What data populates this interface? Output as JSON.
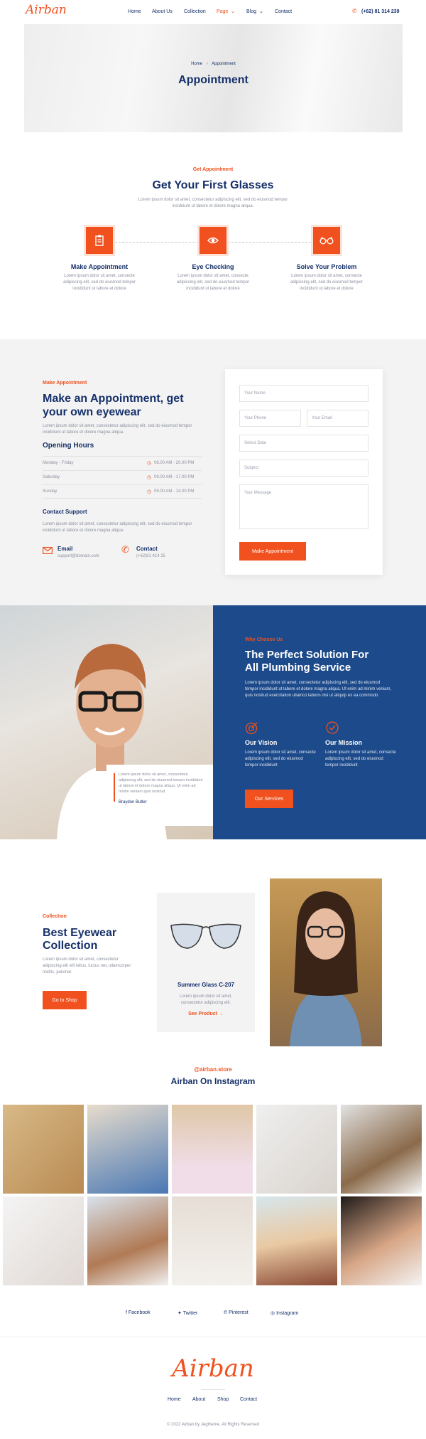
{
  "header": {
    "logo": "Airban",
    "nav": [
      "Home",
      "About Us",
      "Collection",
      "Page",
      "Blog",
      "Contact"
    ],
    "phone": "(+62) 81 314 239"
  },
  "hero": {
    "breadcrumb_home": "Home",
    "breadcrumb_current": "Appointment",
    "title": "Appointment"
  },
  "steps_section": {
    "eyebrow": "Get Appointment",
    "title": "Get Your First Glasses",
    "intro": "Lorem ipsum dolor sit amet, consectetur adipiscing elit, sed do eiusmod tempor incididunt ut labore et dolore magna aliqua.",
    "steps": [
      {
        "title": "Make Appointment",
        "text": "Lorem ipsum dolor sit amet, consecte adipiscing elit, sed do eiusmod tempor incididunt ut labore et dolore",
        "icon": "clipboard-icon"
      },
      {
        "title": "Eye Checking",
        "text": "Lorem ipsum dolor sit amet, consecte adipiscing elit, sed do eiusmod tempor incididunt ut labore et dolore",
        "icon": "eye-icon"
      },
      {
        "title": "Solve Your Problem",
        "text": "Lorem ipsum dolor sit amet, consecte adipiscing elit, sed do eiusmod tempor incididunt ut labore et dolore",
        "icon": "glasses-icon"
      }
    ]
  },
  "appointment": {
    "eyebrow": "Make Appointment",
    "title_line1": "Make an Appointment, get",
    "title_line2": "your own eyewear",
    "intro": "Lorem ipsum dolor sit amet, consectetur adipiscing elit, sed do eiusmod tempor incididunt ut labore et dolore magna aliqua.",
    "hours_title": "Opening Hours",
    "hours": [
      {
        "day": "Monday - Friday",
        "time": "08.00 AM - 20.00 PM"
      },
      {
        "day": "Saturday",
        "time": "09.00 AM - 17.00 PM"
      },
      {
        "day": "Sunday",
        "time": "09.00 AM - 14.00 PM"
      }
    ],
    "support_title": "Contact Support",
    "support_text": "Lorem ipsum dolor sit amet, consectetur adipiscing elit, sed do eiusmod tempor incididunt ut labore et dolore magna aliqua.",
    "email_label": "Email",
    "email_value": "support@domain.com",
    "contact_label": "Contact",
    "contact_value": "(+62)81 414 25",
    "form": {
      "name": "Your Name",
      "phone": "Your Phone",
      "email": "Your Email",
      "date": "Select Date",
      "subject": "Subject",
      "message": "Your Message",
      "submit": "Make Appointment"
    }
  },
  "why": {
    "quote": "Lorem ipsum dolor sit amet, consectetur adipiscing elit, sed do eiusmod tempor incididunt ut labore et dolore magna aliqua. Ut enim ad minim veniam quis nostrud",
    "quote_author": "Braydon Butler",
    "eyebrow": "Why Choose Us",
    "title_line1": "The Perfect Solution For",
    "title_line2": "All Plumbing Service",
    "text": "Lorem ipsum dolor sit amet, consectetur adipiscing elit, sed do eiusmod tempor incididunt ut labore et dolore magna aliqua. Ut enim ad minim veniam, quis nostrud exercitation ullamco laboris nisi ut aliquip ex ea commodo",
    "vision_title": "Our Vision",
    "vision_text": "Lorem ipsum dolor sit amet, consecte adipiscing elit, sed do eiusmod tempor incididunt",
    "mission_title": "Our Mission",
    "mission_text": "Lorem ipsum dolor sit amet, consecte adipiscing elit, sed do eiusmod tempor incididunt",
    "button": "Our Services"
  },
  "collection": {
    "eyebrow": "Collection",
    "title_line1": "Best Eyewear",
    "title_line2": "Collection",
    "text": "Lorem ipsum dolor sit amet, consectetur adipiscing elit elit tellus, luctus nec ullamcorper mattis, pulvinar.",
    "button": "Go to Shop",
    "product_name": "Summer Glass C-207",
    "product_text": "Lorem ipsum dolor sit amet, consectetur adipiscing elit.",
    "product_link": "See Product"
  },
  "instagram": {
    "handle": "@airban.store",
    "title": "Airban On Instagram"
  },
  "social": [
    "Facebook",
    "Twitter",
    "Pinterest",
    "Instagram"
  ],
  "footer": {
    "logo": "Airban",
    "links": [
      "Home",
      "About",
      "Shop",
      "Contact"
    ],
    "copyright": "© 2022 Airban by Jegtheme. All Rights Reserved"
  },
  "colors": {
    "accent": "#f0511e",
    "navy": "#16306a",
    "blue_panel": "#1c4a8a"
  }
}
